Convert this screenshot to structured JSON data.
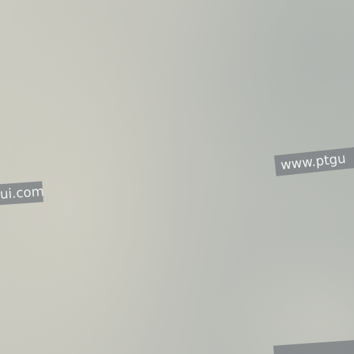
{
  "watermarks": {
    "left_text": "ui.com",
    "right_text": "www.ptgu",
    "bottom_text": ""
  }
}
